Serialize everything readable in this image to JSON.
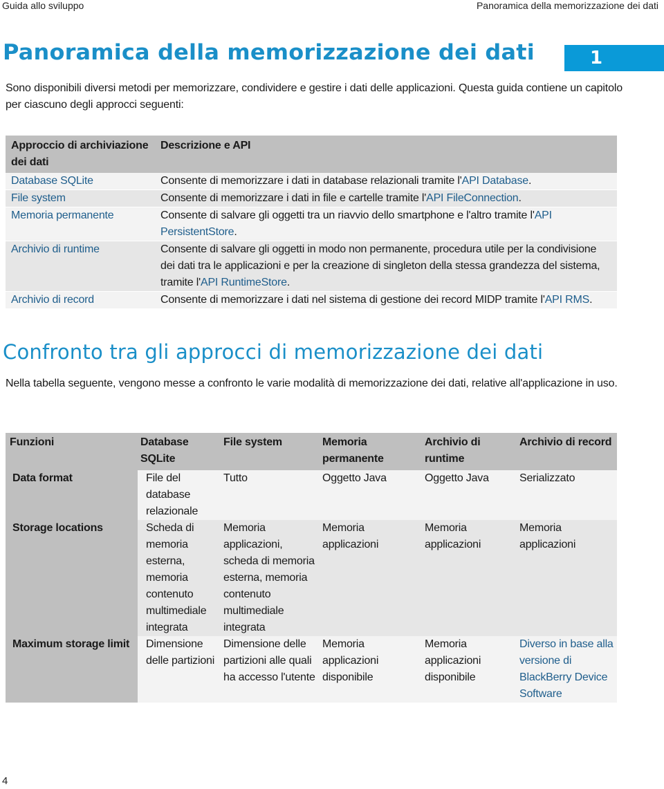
{
  "header": {
    "left": "Guida allo sviluppo",
    "right": "Panoramica della memorizzazione dei dati"
  },
  "chapter": {
    "title": "Panoramica della memorizzazione dei dati",
    "number": "1",
    "accent_color": "#0a9ad8"
  },
  "intro": "Sono disponibili diversi metodi per memorizzare, condividere e gestire i dati delle applicazioni. Questa guida contiene un capitolo per ciascuno degli approcci seguenti:",
  "approaches_table": {
    "headers": [
      "Approccio di archiviazione dei dati",
      "Descrizione e API"
    ],
    "rows": [
      {
        "name": "Database SQLite",
        "desc": "Consente di memorizzare i dati in database relazionali tramite l'",
        "api": "API Database",
        "tail": "."
      },
      {
        "name": "File system",
        "desc": "Consente di memorizzare i dati in file e cartelle tramite l'",
        "api": "API FileConnection",
        "tail": "."
      },
      {
        "name": "Memoria permanente",
        "desc": "Consente di salvare gli oggetti tra un riavvio dello smartphone e l'altro tramite l'",
        "api": "API PersistentStore",
        "tail": "."
      },
      {
        "name": "Archivio di runtime",
        "desc": "Consente di salvare gli oggetti in modo non permanente, procedura utile per la condivisione dei dati tra le applicazioni e per la creazione di singleton della stessa grandezza del sistema, tramite l'",
        "api": "API RuntimeStore",
        "tail": "."
      },
      {
        "name": "Archivio di record",
        "desc": "Consente di memorizzare i dati nel sistema di gestione dei record MIDP tramite l'",
        "api": "API RMS",
        "tail": "."
      }
    ]
  },
  "section": {
    "title": "Confronto tra gli approcci di memorizzazione dei dati",
    "intro": "Nella tabella seguente, vengono messe a confronto le varie modalità di memorizzazione dei dati, relative all'applicazione in uso."
  },
  "comparison_table": {
    "headers": [
      "Funzioni",
      "Database SQLite",
      "File system",
      "Memoria permanente",
      "Archivio di runtime",
      "Archivio di record"
    ],
    "rows": [
      {
        "feature": "Data format",
        "values": [
          "File del database relazionale",
          "Tutto",
          "Oggetto Java",
          "Oggetto Java",
          "Serializzato"
        ]
      },
      {
        "feature": "Storage locations",
        "values": [
          "Scheda di memoria esterna, memoria contenuto multimediale integrata",
          "Memoria applicazioni, scheda di memoria esterna, memoria contenuto multimediale integrata",
          "Memoria applicazioni",
          "Memoria applicazioni",
          "Memoria applicazioni"
        ]
      },
      {
        "feature": "Maximum storage limit",
        "values": [
          "Dimensione delle partizioni",
          "Dimensione delle partizioni alle quali ha accesso l'utente",
          "Memoria applicazioni disponibile",
          "Memoria applicazioni disponibile",
          "Diverso in base alla versione di BlackBerry Device Software"
        ]
      }
    ]
  },
  "footer": {
    "page_number": "4"
  }
}
